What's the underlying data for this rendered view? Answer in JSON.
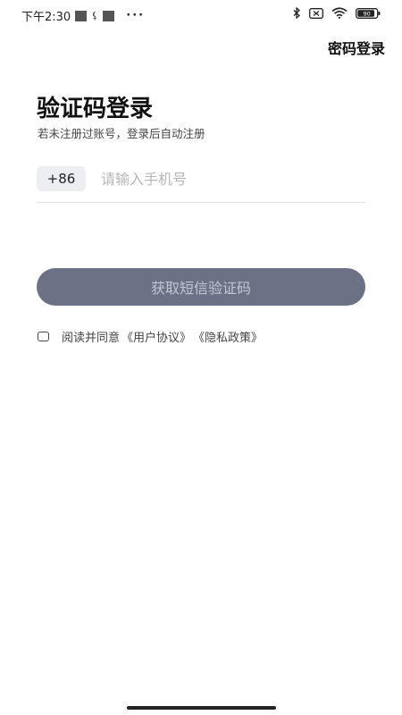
{
  "status_bar": {
    "time": "下午2:30",
    "left_icons": [
      "image-icon",
      "usb-icon",
      "image-icon",
      "more-dots-icon"
    ],
    "right_icons": [
      "bluetooth-icon",
      "no-sim-icon",
      "wifi-icon",
      "battery-icon"
    ],
    "battery_level": 0.9,
    "battery_text": "90"
  },
  "header": {
    "password_login_label": "密码登录"
  },
  "main": {
    "title": "验证码登录",
    "subtitle": "若未注册过账号，登录后自动注册",
    "country_code": "+86",
    "phone_placeholder": "请输入手机号",
    "phone_value": "",
    "sms_button_label": "获取短信验证码",
    "agree": {
      "checked": false,
      "prefix": "阅读并同意",
      "user_agreement": "《用户协议》",
      "privacy_policy": "《隐私政策》"
    }
  },
  "colors": {
    "button_bg": "#6c7185",
    "button_text": "#c3c6d1",
    "country_bg": "#eceef1",
    "placeholder": "#b6b6b6"
  }
}
